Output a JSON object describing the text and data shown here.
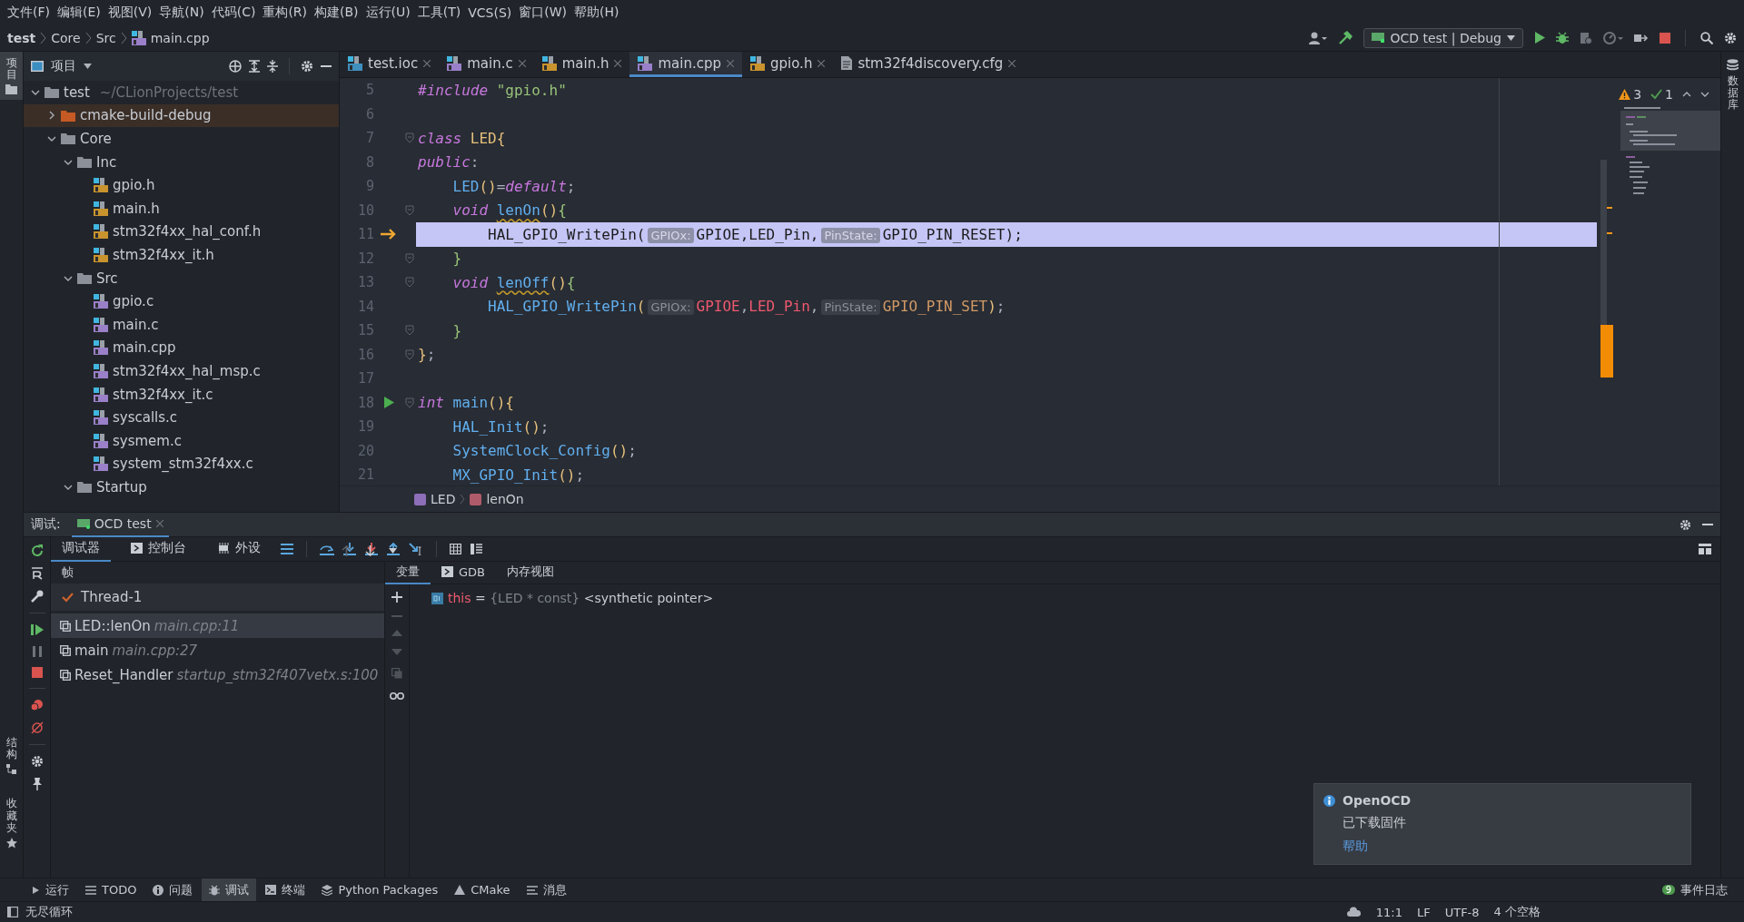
{
  "menu": [
    "文件(F)",
    "编辑(E)",
    "视图(V)",
    "导航(N)",
    "代码(C)",
    "重构(R)",
    "构建(B)",
    "运行(U)",
    "工具(T)",
    "VCS(S)",
    "窗口(W)",
    "帮助(H)"
  ],
  "breadcrumb": [
    "test",
    "Core",
    "Src",
    "main.cpp"
  ],
  "run_configuration": "OCD test | Debug",
  "left_stripe": {
    "top": [
      {
        "label": "项目",
        "selected": true
      }
    ],
    "bottom": [
      {
        "label": "结构",
        "kind": "structure"
      },
      {
        "label": "收藏夹",
        "kind": "favorites"
      }
    ]
  },
  "project_panel": {
    "title": "项目",
    "tree": [
      {
        "name": "test",
        "path": "~/CLionProjects/test",
        "kind": "folder",
        "expanded": true,
        "selected": false,
        "children": [
          {
            "name": "cmake-build-debug",
            "kind": "excluded",
            "expanded": false,
            "selected": true
          },
          {
            "name": "Core",
            "kind": "folder",
            "expanded": true,
            "selected": false,
            "children": [
              {
                "name": "Inc",
                "kind": "folder",
                "expanded": true,
                "selected": false,
                "children": [
                  {
                    "name": "gpio.h",
                    "kind": "header",
                    "selected": false
                  },
                  {
                    "name": "main.h",
                    "kind": "header",
                    "selected": false
                  },
                  {
                    "name": "stm32f4xx_hal_conf.h",
                    "kind": "header",
                    "selected": false
                  },
                  {
                    "name": "stm32f4xx_it.h",
                    "kind": "header",
                    "selected": false
                  }
                ]
              },
              {
                "name": "Src",
                "kind": "folder",
                "expanded": true,
                "selected": false,
                "children": [
                  {
                    "name": "gpio.c",
                    "kind": "c",
                    "selected": false
                  },
                  {
                    "name": "main.c",
                    "kind": "c",
                    "selected": false
                  },
                  {
                    "name": "main.cpp",
                    "kind": "cpp",
                    "selected": false
                  },
                  {
                    "name": "stm32f4xx_hal_msp.c",
                    "kind": "c",
                    "selected": false
                  },
                  {
                    "name": "stm32f4xx_it.c",
                    "kind": "c",
                    "selected": false
                  },
                  {
                    "name": "syscalls.c",
                    "kind": "c",
                    "selected": false
                  },
                  {
                    "name": "sysmem.c",
                    "kind": "c",
                    "selected": false
                  },
                  {
                    "name": "system_stm32f4xx.c",
                    "kind": "c",
                    "selected": false
                  }
                ]
              },
              {
                "name": "Startup",
                "kind": "folder",
                "expanded": true,
                "selected": false
              }
            ]
          }
        ]
      }
    ]
  },
  "editor": {
    "tabs": [
      {
        "label": "test.ioc",
        "kind": "ioc",
        "selected": false
      },
      {
        "label": "main.c",
        "kind": "c",
        "selected": false
      },
      {
        "label": "main.h",
        "kind": "header",
        "selected": false
      },
      {
        "label": "main.cpp",
        "kind": "cpp",
        "selected": true
      },
      {
        "label": "gpio.h",
        "kind": "header",
        "selected": false
      },
      {
        "label": "stm32f4discovery.cfg",
        "kind": "cfg",
        "selected": false
      }
    ],
    "inspections": {
      "warnings": "3",
      "weak_warnings": "1"
    },
    "lines": [
      {
        "number": "5",
        "execution_point": false,
        "run_marker": false,
        "fold": false,
        "current": false,
        "tokens": [
          {
            "text": "#include",
            "kind": "kw"
          },
          {
            "text": " \"gpio.h\"",
            "kind": "string"
          }
        ]
      },
      {
        "number": "6",
        "execution_point": false,
        "run_marker": false,
        "fold": false,
        "current": false
      },
      {
        "number": "7",
        "execution_point": false,
        "run_marker": false,
        "fold": true,
        "current": false,
        "tokens": [
          {
            "text": "class",
            "kind": "kw"
          },
          {
            "text": " LED",
            "kind": "type"
          },
          {
            "text": "{",
            "kind": "punct"
          }
        ]
      },
      {
        "number": "8",
        "execution_point": false,
        "run_marker": false,
        "fold": false,
        "current": false,
        "tokens": [
          {
            "text": "public",
            "kind": "kw"
          },
          {
            "text": ":",
            "kind": "plain"
          }
        ]
      },
      {
        "number": "9",
        "execution_point": false,
        "run_marker": false,
        "fold": false,
        "current": false,
        "tokens": [
          {
            "text": "    LED",
            "kind": "fn"
          },
          {
            "text": "()",
            "kind": "punct"
          },
          {
            "text": "=",
            "kind": "plain"
          },
          {
            "text": "default",
            "kind": "kw"
          },
          {
            "text": ";",
            "kind": "plain"
          }
        ]
      },
      {
        "number": "10",
        "execution_point": false,
        "run_marker": false,
        "fold": true,
        "current": false,
        "tokens": [
          {
            "text": "    void ",
            "kind": "kw"
          },
          {
            "text": "lenOn",
            "kind": "fn-warn"
          },
          {
            "text": "()",
            "kind": "punct"
          },
          {
            "text": "{",
            "kind": "brace"
          }
        ]
      },
      {
        "number": "11",
        "execution_point": true,
        "run_marker": false,
        "fold": false,
        "current": true,
        "tokens": [
          {
            "text": "        HAL_GPIO_WritePin",
            "kind": "fn"
          },
          {
            "text": "(",
            "kind": "punct"
          },
          {
            "text": "GPIOx:",
            "kind": "hint"
          },
          {
            "text": "GPIOE",
            "kind": "macro"
          },
          {
            "text": ",",
            "kind": "plain"
          },
          {
            "text": "LED_Pin",
            "kind": "macro"
          },
          {
            "text": ",",
            "kind": "plain"
          },
          {
            "text": "PinState:",
            "kind": "hint"
          },
          {
            "text": "GPIO_PIN_RESET",
            "kind": "const"
          },
          {
            "text": ")",
            "kind": "punct"
          },
          {
            "text": ";",
            "kind": "plain"
          }
        ]
      },
      {
        "number": "12",
        "execution_point": false,
        "run_marker": false,
        "fold": true,
        "current": false,
        "tokens": [
          {
            "text": "    }",
            "kind": "brace"
          }
        ]
      },
      {
        "number": "13",
        "execution_point": false,
        "run_marker": false,
        "fold": true,
        "current": false,
        "tokens": [
          {
            "text": "    void ",
            "kind": "kw"
          },
          {
            "text": "lenOff",
            "kind": "fn-warn"
          },
          {
            "text": "()",
            "kind": "punct"
          },
          {
            "text": "{",
            "kind": "brace"
          }
        ]
      },
      {
        "number": "14",
        "execution_point": false,
        "run_marker": false,
        "fold": false,
        "current": false,
        "tokens": [
          {
            "text": "        HAL_GPIO_WritePin",
            "kind": "fn"
          },
          {
            "text": "(",
            "kind": "punct"
          },
          {
            "text": "GPIOx:",
            "kind": "hint"
          },
          {
            "text": "GPIOE",
            "kind": "macro"
          },
          {
            "text": ",",
            "kind": "plain"
          },
          {
            "text": "LED_Pin",
            "kind": "macro"
          },
          {
            "text": ",",
            "kind": "plain"
          },
          {
            "text": "PinState:",
            "kind": "hint"
          },
          {
            "text": "GPIO_PIN_SET",
            "kind": "const"
          },
          {
            "text": ")",
            "kind": "punct"
          },
          {
            "text": ";",
            "kind": "plain"
          }
        ]
      },
      {
        "number": "15",
        "execution_point": false,
        "run_marker": false,
        "fold": true,
        "current": false,
        "tokens": [
          {
            "text": "    }",
            "kind": "brace"
          }
        ]
      },
      {
        "number": "16",
        "execution_point": false,
        "run_marker": false,
        "fold": true,
        "current": false,
        "tokens": [
          {
            "text": "}",
            "kind": "punct"
          },
          {
            "text": ";",
            "kind": "plain"
          }
        ]
      },
      {
        "number": "17",
        "execution_point": false,
        "run_marker": false,
        "fold": false,
        "current": false
      },
      {
        "number": "18",
        "execution_point": false,
        "run_marker": true,
        "fold": true,
        "current": false,
        "tokens": [
          {
            "text": "int",
            "kind": "kw"
          },
          {
            "text": " main",
            "kind": "fn"
          },
          {
            "text": "()",
            "kind": "punct"
          },
          {
            "text": "{",
            "kind": "punct"
          }
        ]
      },
      {
        "number": "19",
        "execution_point": false,
        "run_marker": false,
        "fold": false,
        "current": false,
        "tokens": [
          {
            "text": "    HAL_Init",
            "kind": "fn"
          },
          {
            "text": "()",
            "kind": "punct"
          },
          {
            "text": ";",
            "kind": "plain"
          }
        ]
      },
      {
        "number": "20",
        "execution_point": false,
        "run_marker": false,
        "fold": false,
        "current": false,
        "tokens": [
          {
            "text": "    SystemClock_Config",
            "kind": "fn"
          },
          {
            "text": "()",
            "kind": "punct"
          },
          {
            "text": ";",
            "kind": "plain"
          }
        ]
      },
      {
        "number": "21",
        "execution_point": false,
        "run_marker": false,
        "fold": false,
        "current": false,
        "tokens": [
          {
            "text": "    MX_GPIO_Init",
            "kind": "fn"
          },
          {
            "text": "()",
            "kind": "punct"
          },
          {
            "text": ";",
            "kind": "plain"
          }
        ]
      }
    ],
    "breadcrumb": [
      {
        "label": "LED",
        "kind": "struct"
      },
      {
        "label": "lenOn",
        "kind": "function"
      }
    ]
  },
  "right_stripe": [
    {
      "label": "数据库"
    }
  ],
  "debug": {
    "title": "调试:",
    "session_tab": "OCD test",
    "tabs": [
      {
        "label": "调试器",
        "kind": "debugger",
        "selected": true
      },
      {
        "label": "控制台",
        "kind": "console",
        "selected": false
      },
      {
        "label": "外设",
        "kind": "peripherals",
        "selected": false
      }
    ],
    "frames_header": "帧",
    "thread": "Thread-1",
    "frames": [
      {
        "function": "LED::lenOn",
        "location": "main.cpp:11",
        "selected": true
      },
      {
        "function": "main",
        "location": "main.cpp:27",
        "selected": false
      },
      {
        "function": "Reset_Handler",
        "location": "startup_stm32f407vetx.s:100",
        "selected": false
      }
    ],
    "variable_tabs": [
      {
        "label": "变量",
        "kind": "variables",
        "selected": true
      },
      {
        "label": "GDB",
        "kind": "gdb",
        "selected": false
      },
      {
        "label": "内存视图",
        "kind": "memory",
        "selected": false
      }
    ],
    "variables": [
      {
        "name": "this",
        "operator": "=",
        "type": "{LED * const}",
        "value": "<synthetic pointer>"
      }
    ]
  },
  "notification": {
    "title": "OpenOCD",
    "message": "已下载固件",
    "link": "帮助"
  },
  "tool_windows": [
    {
      "label": "运行",
      "kind": "run",
      "selected": false
    },
    {
      "label": "TODO",
      "kind": "todo",
      "selected": false
    },
    {
      "label": "问题",
      "kind": "problems",
      "selected": false
    },
    {
      "label": "调试",
      "kind": "debug",
      "selected": true
    },
    {
      "label": "终端",
      "kind": "terminal",
      "selected": false
    },
    {
      "label": "Python Packages",
      "kind": "python",
      "selected": false
    },
    {
      "label": "CMake",
      "kind": "cmake",
      "selected": false
    },
    {
      "label": "消息",
      "kind": "messages",
      "selected": false
    }
  ],
  "event_log": {
    "label": "事件日志",
    "count": "9"
  },
  "status_bar": {
    "message": "无尽循环",
    "position": "11:1",
    "line_separator": "LF",
    "encoding": "UTF-8",
    "indent": "4 个空格"
  }
}
